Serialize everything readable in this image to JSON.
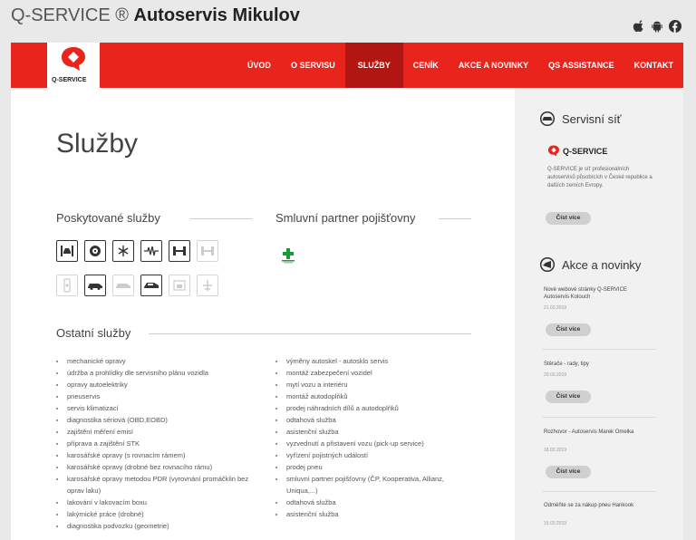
{
  "site": {
    "brand": "Q-SERVICE ®",
    "name": "Autoservis Mikulov",
    "logo_text": "Q-SERVICE"
  },
  "social": [
    "apple-icon",
    "android-icon",
    "facebook-icon"
  ],
  "nav": [
    "ÚVOD",
    "O SERVISU",
    "SLUŽBY",
    "CENÍK",
    "AKCE A NOVINKY",
    "QS ASSISTANCE",
    "KONTAKT"
  ],
  "colors": {
    "primary": "#e8241c",
    "active": "#b11612",
    "partner": "#1a9a3a"
  },
  "main": {
    "title": "Služby",
    "provided_title": "Poskytované služby",
    "partner_title": "Smluvní partner pojišťovny",
    "other_title": "Ostatní služby",
    "service_icons": [
      {
        "icon": "car-lift-icon",
        "active": true
      },
      {
        "icon": "tire-icon",
        "active": true
      },
      {
        "icon": "air-conditioning-icon",
        "active": true
      },
      {
        "icon": "diagnostics-icon",
        "active": true
      },
      {
        "icon": "wheel-alignment-icon",
        "active": true
      },
      {
        "icon": "axle-icon",
        "active": false
      },
      {
        "icon": "engine-icon",
        "active": false
      },
      {
        "icon": "car-repair-icon",
        "active": true
      },
      {
        "icon": "car-wash-icon",
        "active": false
      },
      {
        "icon": "car-body-icon",
        "active": true
      },
      {
        "icon": "paint-booth-icon",
        "active": false
      },
      {
        "icon": "airplane-icon",
        "active": false
      }
    ],
    "list_left": [
      "mechanické opravy",
      "údržba a prohlídky dle servisního plánu vozidla",
      "opravy autoelektriky",
      "pneuservis",
      "servis klimatizací",
      "diagnostika sériová (OBD,EOBD)",
      "zajištění měření emisí",
      "příprava a zajištění STK",
      "karosářské opravy (s rovnacím rámem)",
      "karosářské opravy (drobné bez rovnacího rámu)",
      "karosářské opravy metodou PDR (vyrovnání promáčklin bez oprav laku)",
      "lakování v lakovacím boxu",
      "lakýrnické práce (drobné)",
      "diagnostika podvozku (geometrie)"
    ],
    "list_right": [
      "výměny autoskel - autosklo servis",
      "montáž zabezpečení vozidel",
      "mytí vozu a interiéru",
      "montáž autodoplňků",
      "prodej náhradních dílů a autodoplňků",
      "odtahová služba",
      "asistenční služba",
      "vyzvednutí a přistavení vozu (pick-up service)",
      "vyřízení pojistných událostí",
      "prodej pneu",
      "smluvní partner pojišťovny (ČP, Kooperativa, Allianz, Uniqua,...)",
      "odtahová služba",
      "asistenční služba"
    ]
  },
  "sidebar": {
    "network_title": "Servisní síť",
    "network_logo": "Q-SERVICE",
    "network_desc": "Q-SERVICE je síť profesionálních autoservisů působících v České republice a dalších zemích Evropy.",
    "read_more": "Číst více",
    "news_title": "Akce a novinky",
    "news": [
      {
        "title": "Nové webové stránky Q-SERVICE Autoservis Kolouch",
        "date": "21.03.2019"
      },
      {
        "title": "Stěrače - rady, tipy",
        "date": "20.03.2019"
      },
      {
        "title": "Rozhovor - Autoservis Marek Omelka",
        "date": "18.03.2019"
      },
      {
        "title": "Odměňte se za nákup pneu Hankook",
        "date": "15.03.2019"
      }
    ]
  }
}
